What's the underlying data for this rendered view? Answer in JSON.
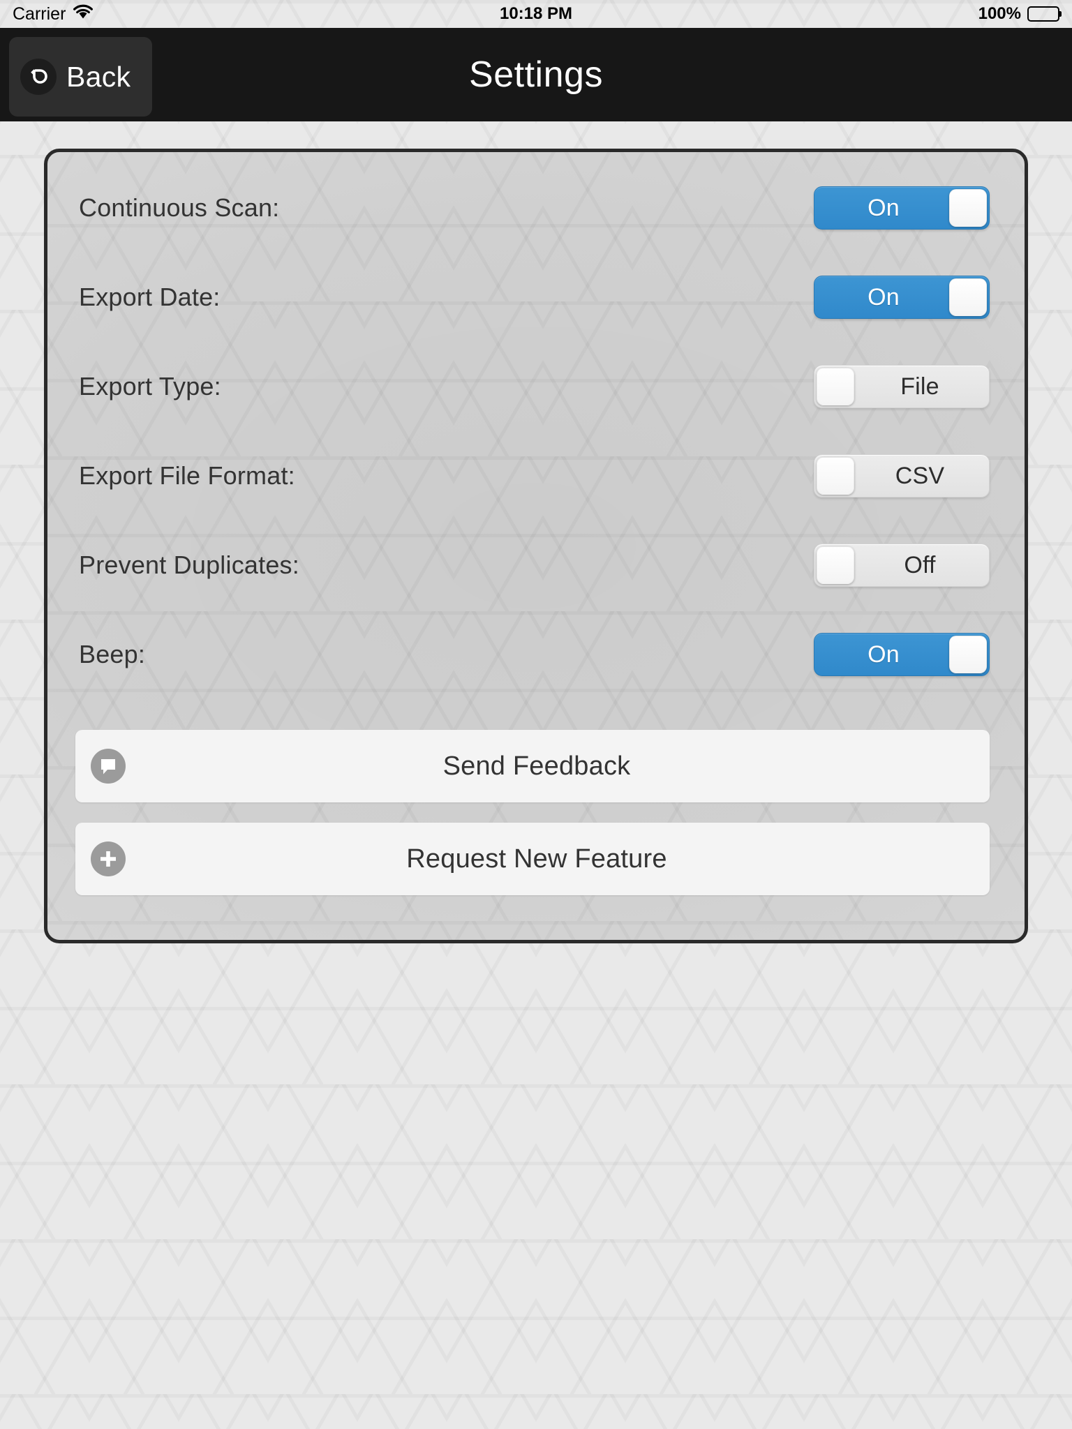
{
  "status_bar": {
    "carrier": "Carrier",
    "wifi_icon": "wifi-icon",
    "time": "10:18 PM",
    "battery_percent": "100%",
    "battery_icon": "battery-full-icon"
  },
  "nav_bar": {
    "back_label": "Back",
    "back_icon": "undo-arrow-icon",
    "title": "Settings"
  },
  "settings": {
    "rows": [
      {
        "label": "Continuous Scan:",
        "value": "On",
        "state": "on"
      },
      {
        "label": "Export Date:",
        "value": "On",
        "state": "on"
      },
      {
        "label": "Export Type:",
        "value": "File",
        "state": "off"
      },
      {
        "label": "Export File Format:",
        "value": "CSV",
        "state": "off"
      },
      {
        "label": "Prevent Duplicates:",
        "value": "Off",
        "state": "off"
      },
      {
        "label": "Beep:",
        "value": "On",
        "state": "on"
      }
    ],
    "actions": [
      {
        "label": "Send Feedback",
        "icon": "speech-bubble-icon"
      },
      {
        "label": "Request New Feature",
        "icon": "plus-circle-icon"
      }
    ]
  },
  "colors": {
    "accent_blue": "#3089cb",
    "nav_background": "#171717",
    "panel_border": "#2a2a2a",
    "panel_background": "#d4d4d4",
    "page_background": "#e9e9e9",
    "button_background": "#f4f4f4",
    "icon_circle": "#9b9b9b",
    "text_primary": "#333333"
  }
}
